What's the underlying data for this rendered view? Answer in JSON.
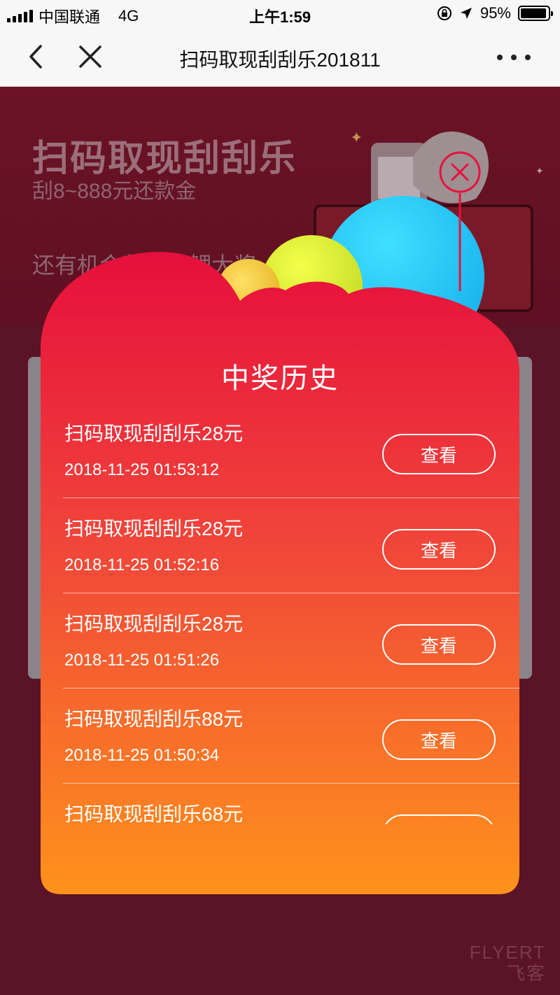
{
  "status_bar": {
    "carrier": "中国联通",
    "network": "4G",
    "time": "上午1:59",
    "battery": "95%",
    "battery_level": 0.95
  },
  "nav": {
    "title": "扫码取现刮刮乐201811"
  },
  "banner": {
    "title": "扫码取现刮刮乐",
    "subtitle": "刮8~888元还款金",
    "line2": "还有机会获得锦鲤大奖"
  },
  "modal": {
    "title": "中奖历史",
    "view_label": "查看",
    "items": [
      {
        "title": "扫码取现刮刮乐28元",
        "time": "2018-11-25 01:53:12"
      },
      {
        "title": "扫码取现刮刮乐28元",
        "time": "2018-11-25 01:52:16"
      },
      {
        "title": "扫码取现刮刮乐28元",
        "time": "2018-11-25 01:51:26"
      },
      {
        "title": "扫码取现刮刮乐88元",
        "time": "2018-11-25 01:50:34"
      },
      {
        "title": "扫码取现刮刮乐68元",
        "time": ""
      }
    ]
  },
  "watermark": {
    "line1": "FLYERT",
    "line2": "飞客"
  },
  "colors": {
    "modal_top": "#e8123b",
    "modal_bottom": "#ff8c1e",
    "page_bg": "#5a1224"
  }
}
